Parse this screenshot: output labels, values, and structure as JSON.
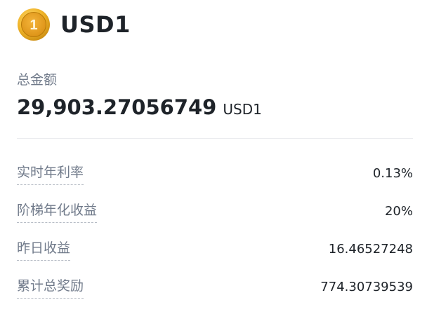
{
  "asset": {
    "name": "USD1",
    "rank_icon": "gold-medal-1-icon",
    "rank_number": "1"
  },
  "total": {
    "label": "总金额",
    "value": "29,903.27056749",
    "unit": "USD1"
  },
  "stats": [
    {
      "label": "实时年利率",
      "value": "0.13%"
    },
    {
      "label": "阶梯年化收益",
      "value": "20%"
    },
    {
      "label": "昨日收益",
      "value": "16.46527248"
    },
    {
      "label": "累计总奖励",
      "value": "774.30739539"
    }
  ],
  "colors": {
    "primary_text": "#1e2329",
    "secondary_text": "#707a8a",
    "medal_gold": "#e7a21b",
    "divider": "#eaecef"
  }
}
